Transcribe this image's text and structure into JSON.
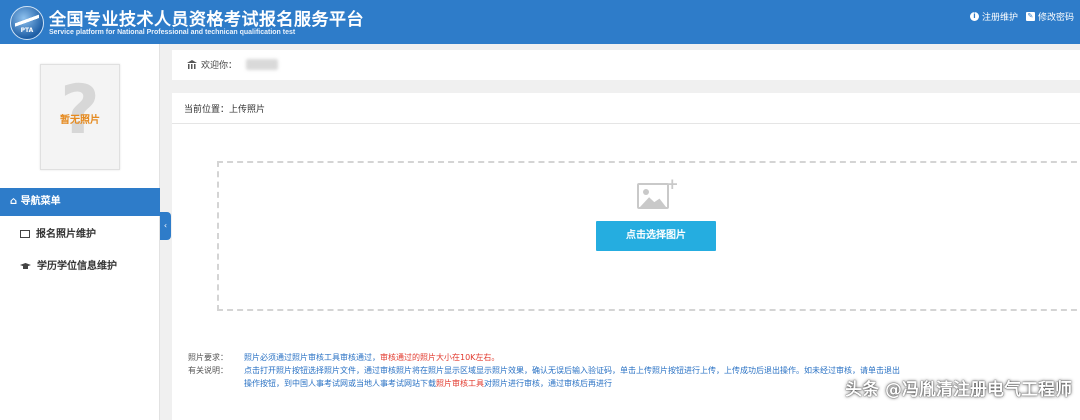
{
  "header": {
    "logo_text": "PTA",
    "title_cn": "全国专业技术人员资格考试报名服务平台",
    "title_en": "Service platform for National Professional and technican qualification test",
    "links": [
      {
        "icon": "info-icon",
        "label": "注册维护"
      },
      {
        "icon": "edit-icon",
        "label": "修改密码"
      }
    ]
  },
  "sidebar": {
    "photo_placeholder": "暂无照片",
    "photo_glyph": "?",
    "nav_header": "导航菜单",
    "nav_items": [
      {
        "icon": "photo-card-icon",
        "label": "报名照片维护"
      },
      {
        "icon": "graduation-cap-icon",
        "label": "学历学位信息维护"
      }
    ],
    "collapse_glyph": "‹"
  },
  "main": {
    "welcome": "欢迎你：",
    "location": "当前位置：上传照片",
    "select_button": "点击选择图片",
    "requirements": {
      "label1": "照片要求：",
      "text1a": "照片必须通过照片审核工具审核通过，",
      "text1b": "审核通过的照片大小在10K左右。",
      "label2": "有关说明：",
      "text2": "点击打开照片按钮选择照片文件，通过审核照片将在照片显示区域显示照片效果，确认无误后输入验证码，单击上传照片按钮进行上传，上传成功后退出操作。如未经过审核，请单击退出",
      "text3a": "操作按钮，到中国人事考试网或当地人事考试网站下载",
      "text3b": "照片审核工具",
      "text3c": "对照片进行审核，通过审核后再进行"
    }
  },
  "watermark": "头条 @冯胤清注册电气工程师",
  "colors": {
    "header_blue": "#2e7cc9",
    "button_cyan": "#25ade0",
    "warning_red": "#e23a2e",
    "link_blue": "#2a72c4",
    "placeholder_orange": "#e58a1f"
  }
}
